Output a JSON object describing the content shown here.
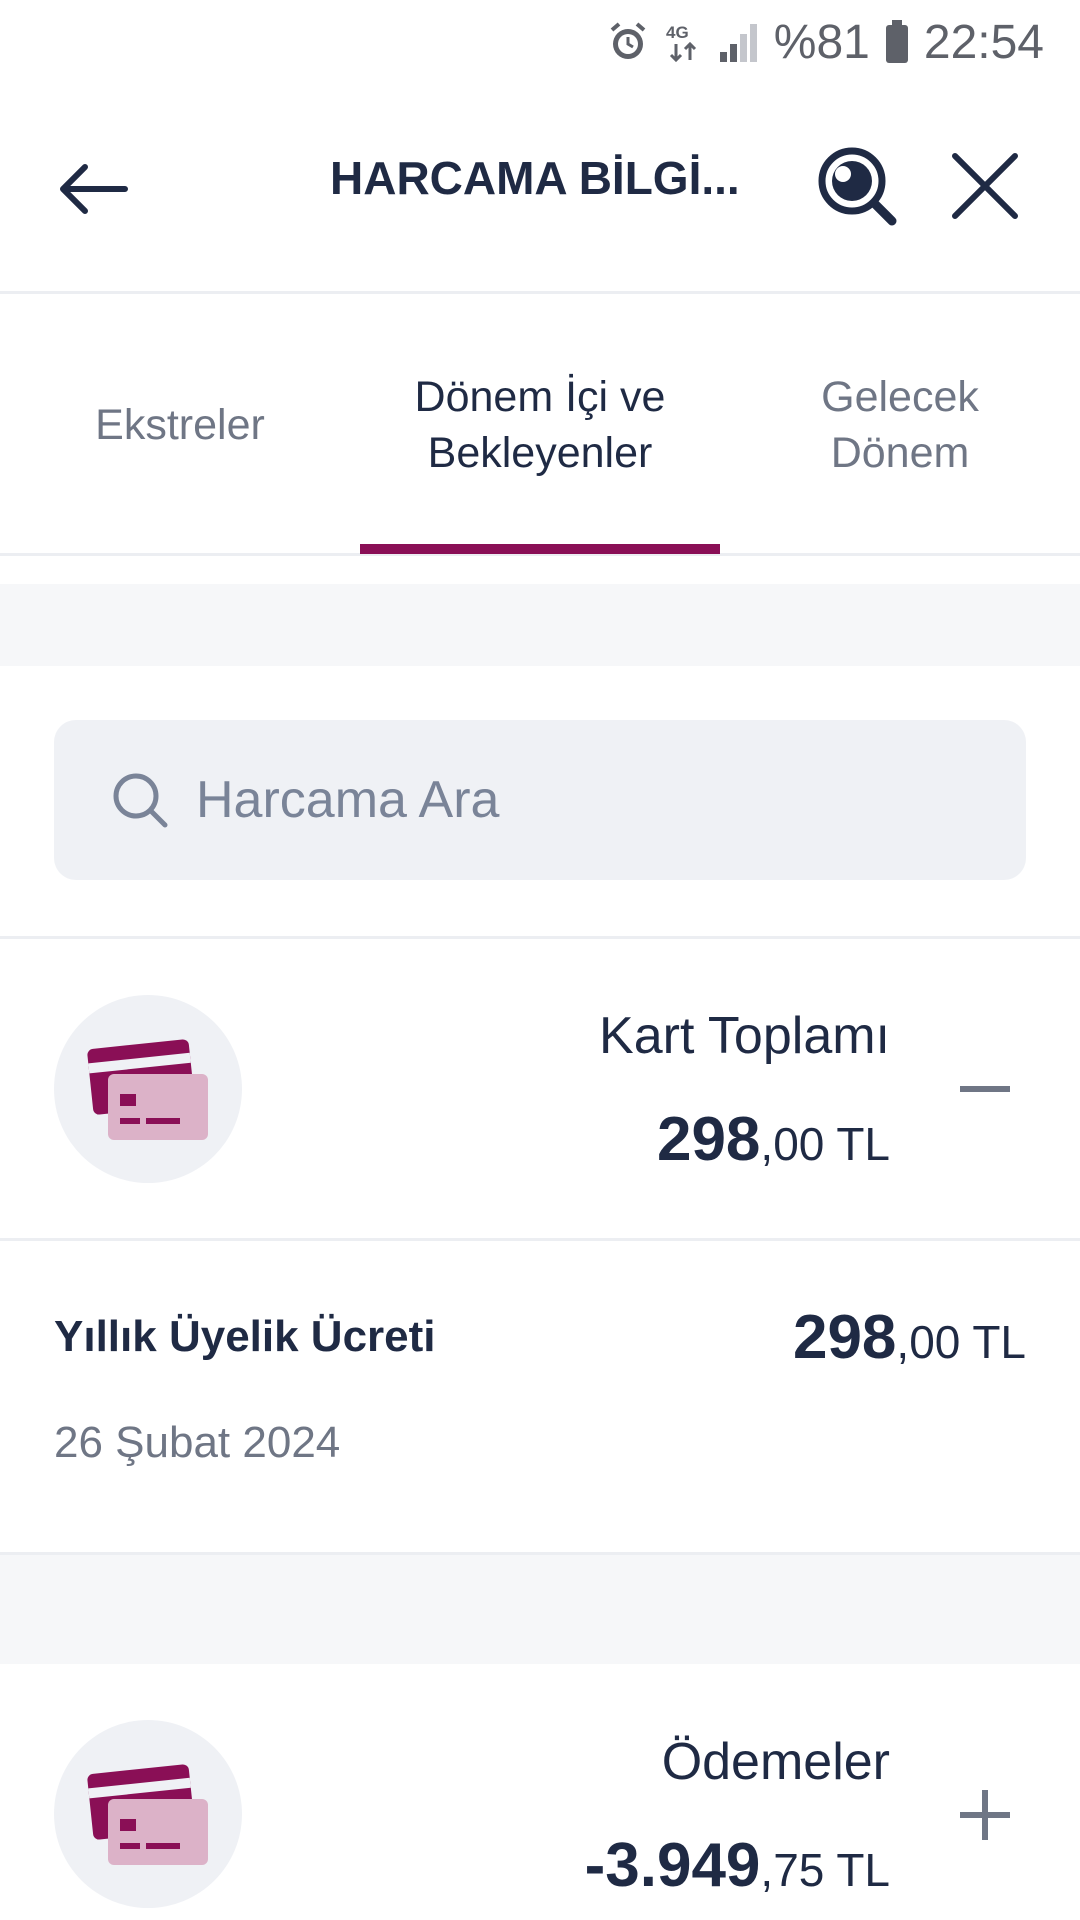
{
  "status_bar": {
    "network": "4G",
    "battery_percent": "%81",
    "time": "22:54",
    "icons": [
      "alarm-icon",
      "network-4g-icon",
      "signal-icon",
      "battery-icon"
    ]
  },
  "header": {
    "title": "HARCAMA BİLGİ...",
    "icons": [
      "back-arrow-icon",
      "insight-search-icon",
      "close-icon"
    ]
  },
  "tabs": [
    {
      "label_line1": "Ekstreler",
      "label_line2": "",
      "active": false
    },
    {
      "label_line1": "Dönem İçi ve",
      "label_line2": "Bekleyenler",
      "active": true
    },
    {
      "label_line1": "Gelecek",
      "label_line2": "Dönem",
      "active": false
    }
  ],
  "search": {
    "placeholder": "Harcama Ara"
  },
  "card_total": {
    "label": "Kart Toplamı",
    "amount_int": "298",
    "amount_dec": ",00 TL",
    "toggle": "collapse-icon"
  },
  "transactions": [
    {
      "name": "Yıllık Üyelik Ücreti",
      "date": "26 Şubat 2024",
      "amount_int": "298",
      "amount_dec": ",00 TL"
    }
  ],
  "payments": {
    "label": "Ödemeler",
    "amount_int": "-3.949",
    "amount_dec": ",75 TL",
    "toggle": "expand-icon"
  },
  "colors": {
    "brand": "#8a0f56",
    "brand_light": "#dcb2c8",
    "text_primary": "#1f2a44",
    "text_secondary": "#6f7685",
    "surface": "#eff1f5"
  }
}
